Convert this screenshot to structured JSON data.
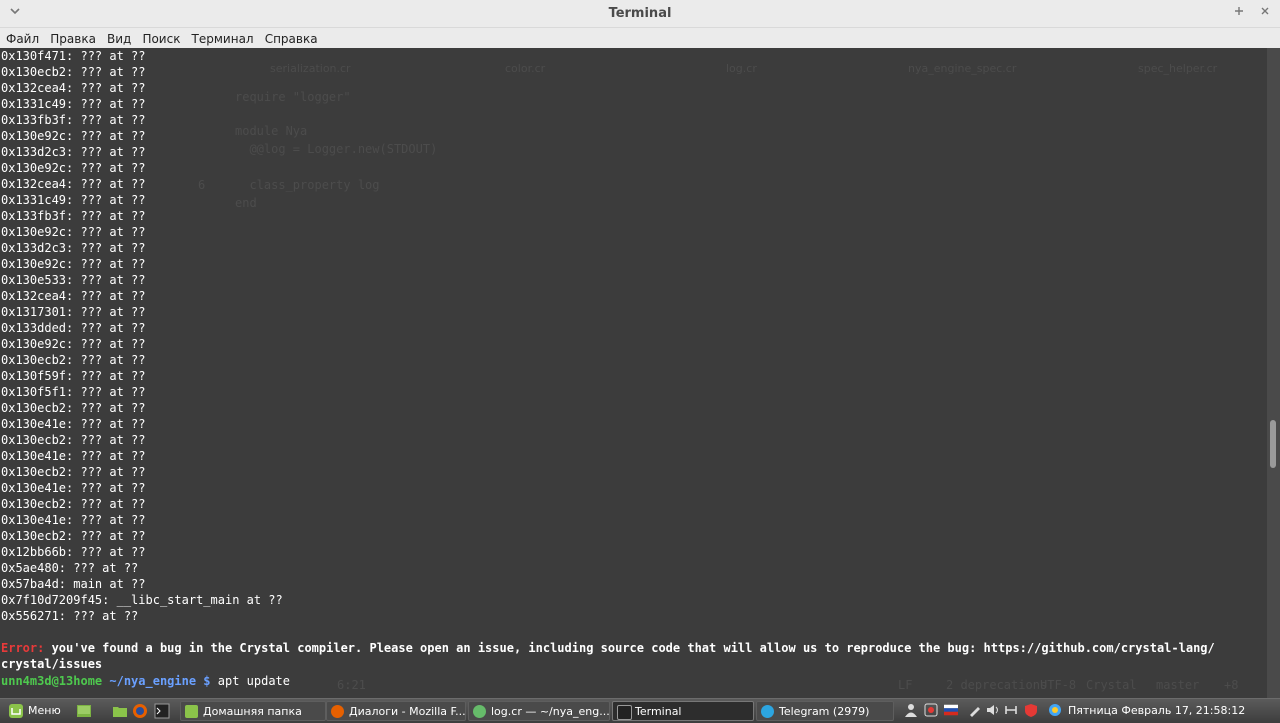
{
  "window": {
    "title": "Terminal",
    "menu_icon": "chevron-down-icon",
    "add_icon": "plus-icon",
    "close_icon": "close-icon"
  },
  "menu": [
    "Файл",
    "Правка",
    "Вид",
    "Поиск",
    "Терминал",
    "Справка"
  ],
  "background_editor": {
    "tabs": [
      "serialization.cr",
      "color.cr",
      "log.cr",
      "nya_engine_spec.cr",
      "spec_helper.cr"
    ],
    "code_lines": [
      "require \"logger\"",
      "",
      "module Nya",
      "  @@log = Logger.new(STDOUT)",
      "",
      "  class_property log",
      "end"
    ],
    "line_numbers": [
      "6"
    ],
    "status": [
      "6:21",
      "LF",
      "2 deprecations",
      "UTF-8",
      "Crystal",
      "master",
      "+8"
    ]
  },
  "terminal": {
    "trace_lines": [
      "0x130f471: ??? at ??",
      "0x130ecb2: ??? at ??",
      "0x132cea4: ??? at ??",
      "0x1331c49: ??? at ??",
      "0x133fb3f: ??? at ??",
      "0x130e92c: ??? at ??",
      "0x133d2c3: ??? at ??",
      "0x130e92c: ??? at ??",
      "0x132cea4: ??? at ??",
      "0x1331c49: ??? at ??",
      "0x133fb3f: ??? at ??",
      "0x130e92c: ??? at ??",
      "0x133d2c3: ??? at ??",
      "0x130e92c: ??? at ??",
      "0x130e533: ??? at ??",
      "0x132cea4: ??? at ??",
      "0x1317301: ??? at ??",
      "0x133dded: ??? at ??",
      "0x130e92c: ??? at ??",
      "0x130ecb2: ??? at ??",
      "0x130f59f: ??? at ??",
      "0x130f5f1: ??? at ??",
      "0x130ecb2: ??? at ??",
      "0x130e41e: ??? at ??",
      "0x130ecb2: ??? at ??",
      "0x130e41e: ??? at ??",
      "0x130ecb2: ??? at ??",
      "0x130e41e: ??? at ??",
      "0x130ecb2: ??? at ??",
      "0x130e41e: ??? at ??",
      "0x130ecb2: ??? at ??",
      "0x12bb66b: ??? at ??",
      "0x5ae480: ??? at ??",
      "0x57ba4d: main at ??",
      "0x7f10d7209f45: __libc_start_main at ??",
      "0x556271: ??? at ??"
    ],
    "error_label": "Error:",
    "error_line1": " you've found a bug in the Crystal compiler. Please open an issue, including source code that will allow us to reproduce the bug: https://github.com/crystal-lang/",
    "error_line2": "crystal/issues",
    "prompt_user": "unn4m3d@13home",
    "prompt_path": " ~/nya_engine $",
    "prompt_command": " apt update"
  },
  "taskbar": {
    "menu_label": "Меню",
    "windows": [
      {
        "label": "Домашняя папка",
        "icon": "folder-icon"
      },
      {
        "label": "Диалоги - Mozilla F...",
        "icon": "firefox-icon"
      },
      {
        "label": "log.cr — ~/nya_eng...",
        "icon": "atom-icon"
      },
      {
        "label": "Terminal",
        "icon": "terminal-icon"
      },
      {
        "label": "Telegram (2979)",
        "icon": "telegram-icon"
      }
    ],
    "clock": "Пятница Февраль 17, 21:58:12"
  }
}
